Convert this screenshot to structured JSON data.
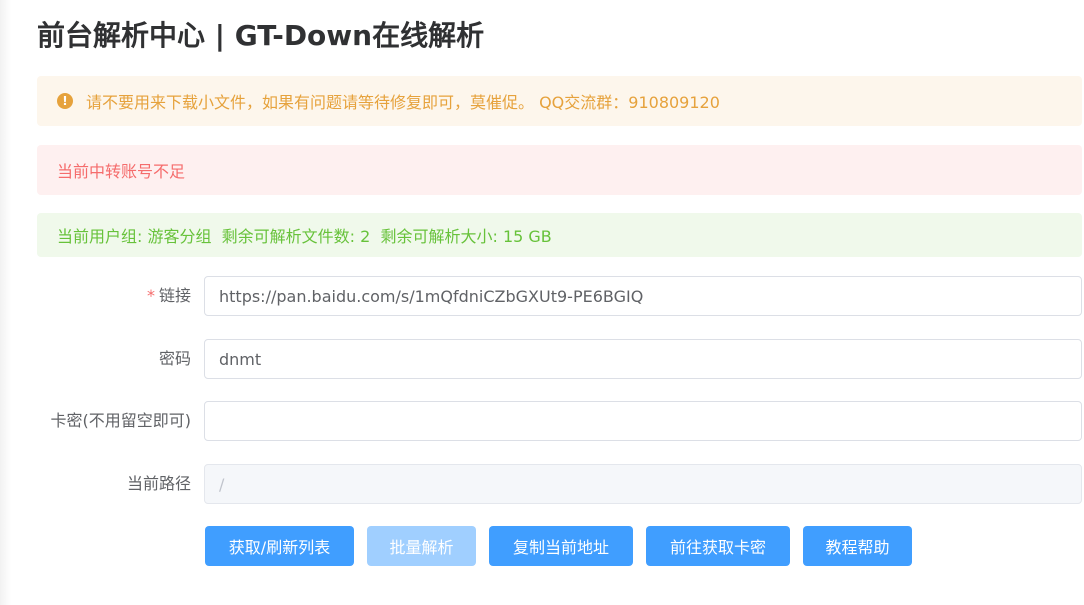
{
  "page": {
    "title": "前台解析中心 | GT-Down在线解析"
  },
  "alerts": {
    "warning": {
      "icon": "!",
      "text": "请不要用来下载小文件，如果有问题请等待修复即可，莫催促。 QQ交流群：910809120"
    },
    "error": {
      "text": "当前中转账号不足"
    },
    "success": {
      "text": "当前用户组: 游客分组  剩余可解析文件数: 2  剩余可解析大小: 15 GB"
    }
  },
  "form": {
    "link": {
      "required_mark": "*",
      "label": "链接",
      "value": "https://pan.baidu.com/s/1mQfdniCZbGXUt9-PE6BGIQ"
    },
    "password": {
      "label": "密码",
      "value": "dnmt"
    },
    "card_key": {
      "label": "卡密(不用留空即可)",
      "value": ""
    },
    "path": {
      "label": "当前路径",
      "value": "/"
    }
  },
  "buttons": {
    "refresh": "获取/刷新列表",
    "batch_parse": "批量解析",
    "copy_path": "复制当前地址",
    "get_key": "前往获取卡密",
    "help": "教程帮助"
  }
}
